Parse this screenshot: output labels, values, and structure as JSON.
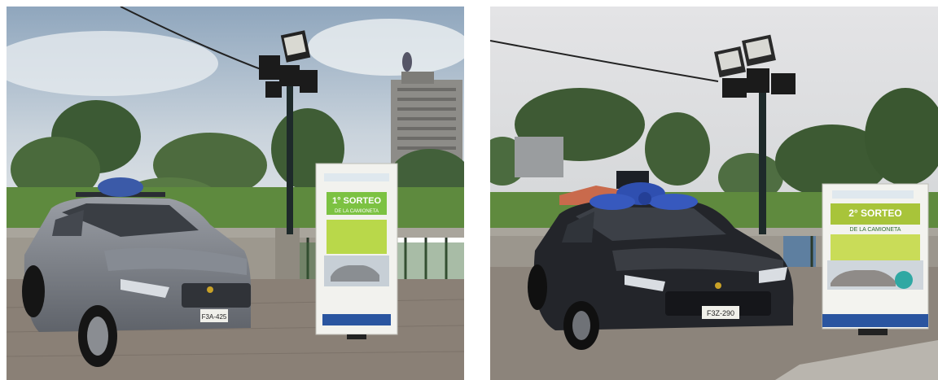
{
  "photos": [
    {
      "id": "left",
      "banner": {
        "heading": "1° SORTEO",
        "subheading": "DE LA CAMIONETA",
        "colors": {
          "green": "#7cc242",
          "teal": "#2fa8a3",
          "blue": "#2a55a0"
        }
      },
      "plate": "F3A-425",
      "car_color": "#7b7f86"
    },
    {
      "id": "right",
      "banner": {
        "heading": "2° SORTEO",
        "subheading": "DE LA CAMIONETA",
        "colors": {
          "green": "#a8c43a",
          "teal": "#2fa8a3",
          "blue": "#2a55a0"
        }
      },
      "plate": "F3Z-290",
      "car_color": "#25272c"
    }
  ]
}
